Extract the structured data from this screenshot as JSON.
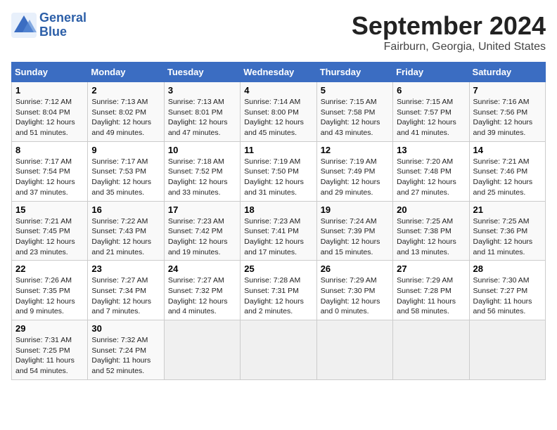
{
  "header": {
    "logo_line1": "General",
    "logo_line2": "Blue",
    "month": "September 2024",
    "location": "Fairburn, Georgia, United States"
  },
  "days_of_week": [
    "Sunday",
    "Monday",
    "Tuesday",
    "Wednesday",
    "Thursday",
    "Friday",
    "Saturday"
  ],
  "weeks": [
    [
      {
        "day": "1",
        "text": "Sunrise: 7:12 AM\nSunset: 8:04 PM\nDaylight: 12 hours\nand 51 minutes."
      },
      {
        "day": "2",
        "text": "Sunrise: 7:13 AM\nSunset: 8:02 PM\nDaylight: 12 hours\nand 49 minutes."
      },
      {
        "day": "3",
        "text": "Sunrise: 7:13 AM\nSunset: 8:01 PM\nDaylight: 12 hours\nand 47 minutes."
      },
      {
        "day": "4",
        "text": "Sunrise: 7:14 AM\nSunset: 8:00 PM\nDaylight: 12 hours\nand 45 minutes."
      },
      {
        "day": "5",
        "text": "Sunrise: 7:15 AM\nSunset: 7:58 PM\nDaylight: 12 hours\nand 43 minutes."
      },
      {
        "day": "6",
        "text": "Sunrise: 7:15 AM\nSunset: 7:57 PM\nDaylight: 12 hours\nand 41 minutes."
      },
      {
        "day": "7",
        "text": "Sunrise: 7:16 AM\nSunset: 7:56 PM\nDaylight: 12 hours\nand 39 minutes."
      }
    ],
    [
      {
        "day": "8",
        "text": "Sunrise: 7:17 AM\nSunset: 7:54 PM\nDaylight: 12 hours\nand 37 minutes."
      },
      {
        "day": "9",
        "text": "Sunrise: 7:17 AM\nSunset: 7:53 PM\nDaylight: 12 hours\nand 35 minutes."
      },
      {
        "day": "10",
        "text": "Sunrise: 7:18 AM\nSunset: 7:52 PM\nDaylight: 12 hours\nand 33 minutes."
      },
      {
        "day": "11",
        "text": "Sunrise: 7:19 AM\nSunset: 7:50 PM\nDaylight: 12 hours\nand 31 minutes."
      },
      {
        "day": "12",
        "text": "Sunrise: 7:19 AM\nSunset: 7:49 PM\nDaylight: 12 hours\nand 29 minutes."
      },
      {
        "day": "13",
        "text": "Sunrise: 7:20 AM\nSunset: 7:48 PM\nDaylight: 12 hours\nand 27 minutes."
      },
      {
        "day": "14",
        "text": "Sunrise: 7:21 AM\nSunset: 7:46 PM\nDaylight: 12 hours\nand 25 minutes."
      }
    ],
    [
      {
        "day": "15",
        "text": "Sunrise: 7:21 AM\nSunset: 7:45 PM\nDaylight: 12 hours\nand 23 minutes."
      },
      {
        "day": "16",
        "text": "Sunrise: 7:22 AM\nSunset: 7:43 PM\nDaylight: 12 hours\nand 21 minutes."
      },
      {
        "day": "17",
        "text": "Sunrise: 7:23 AM\nSunset: 7:42 PM\nDaylight: 12 hours\nand 19 minutes."
      },
      {
        "day": "18",
        "text": "Sunrise: 7:23 AM\nSunset: 7:41 PM\nDaylight: 12 hours\nand 17 minutes."
      },
      {
        "day": "19",
        "text": "Sunrise: 7:24 AM\nSunset: 7:39 PM\nDaylight: 12 hours\nand 15 minutes."
      },
      {
        "day": "20",
        "text": "Sunrise: 7:25 AM\nSunset: 7:38 PM\nDaylight: 12 hours\nand 13 minutes."
      },
      {
        "day": "21",
        "text": "Sunrise: 7:25 AM\nSunset: 7:36 PM\nDaylight: 12 hours\nand 11 minutes."
      }
    ],
    [
      {
        "day": "22",
        "text": "Sunrise: 7:26 AM\nSunset: 7:35 PM\nDaylight: 12 hours\nand 9 minutes."
      },
      {
        "day": "23",
        "text": "Sunrise: 7:27 AM\nSunset: 7:34 PM\nDaylight: 12 hours\nand 7 minutes."
      },
      {
        "day": "24",
        "text": "Sunrise: 7:27 AM\nSunset: 7:32 PM\nDaylight: 12 hours\nand 4 minutes."
      },
      {
        "day": "25",
        "text": "Sunrise: 7:28 AM\nSunset: 7:31 PM\nDaylight: 12 hours\nand 2 minutes."
      },
      {
        "day": "26",
        "text": "Sunrise: 7:29 AM\nSunset: 7:30 PM\nDaylight: 12 hours\nand 0 minutes."
      },
      {
        "day": "27",
        "text": "Sunrise: 7:29 AM\nSunset: 7:28 PM\nDaylight: 11 hours\nand 58 minutes."
      },
      {
        "day": "28",
        "text": "Sunrise: 7:30 AM\nSunset: 7:27 PM\nDaylight: 11 hours\nand 56 minutes."
      }
    ],
    [
      {
        "day": "29",
        "text": "Sunrise: 7:31 AM\nSunset: 7:25 PM\nDaylight: 11 hours\nand 54 minutes."
      },
      {
        "day": "30",
        "text": "Sunrise: 7:32 AM\nSunset: 7:24 PM\nDaylight: 11 hours\nand 52 minutes."
      },
      {
        "day": "",
        "text": ""
      },
      {
        "day": "",
        "text": ""
      },
      {
        "day": "",
        "text": ""
      },
      {
        "day": "",
        "text": ""
      },
      {
        "day": "",
        "text": ""
      }
    ]
  ]
}
